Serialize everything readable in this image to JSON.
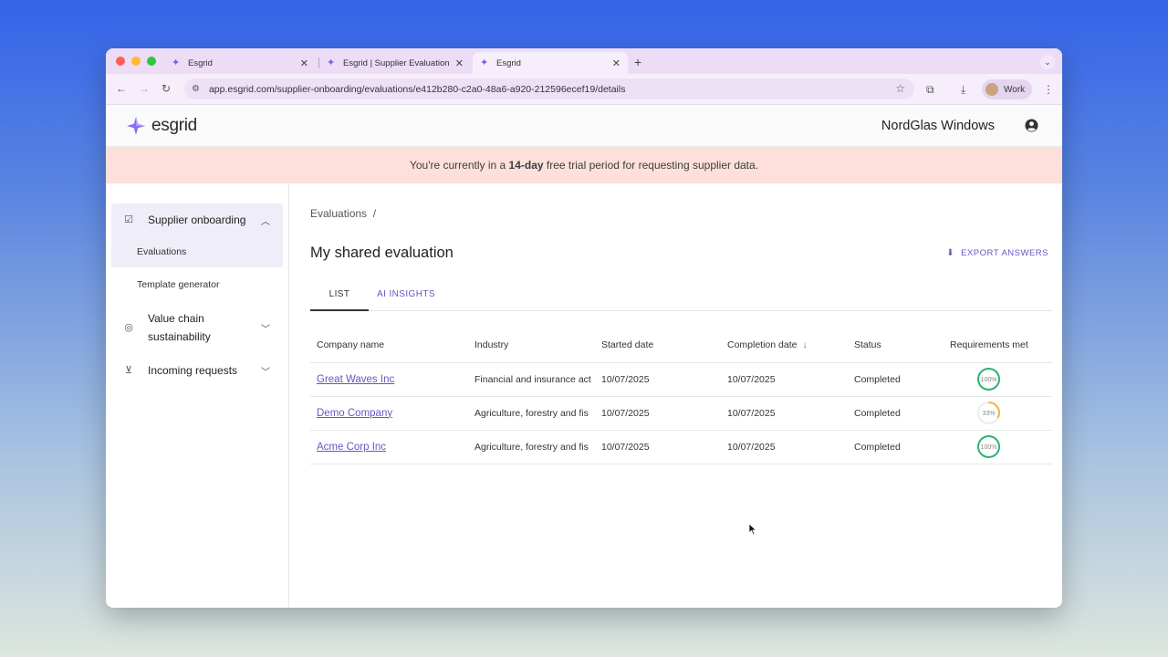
{
  "browser": {
    "tabs": [
      {
        "title": "Esgrid"
      },
      {
        "title": "Esgrid | Supplier Evaluation To"
      },
      {
        "title": "Esgrid"
      }
    ],
    "url": "app.esgrid.com/supplier-onboarding/evaluations/e412b280-c2a0-48a6-a920-212596ecef19/details",
    "profile_label": "Work"
  },
  "app": {
    "logo_text": "esgrid",
    "org_name": "NordGlas Windows",
    "brand_color": "#7b5ce6"
  },
  "banner": {
    "prefix": "You're currently in a ",
    "highlight": "14-day",
    "suffix": " free trial period for requesting supplier data."
  },
  "sidebar": {
    "items": [
      {
        "label": "Supplier onboarding",
        "icon": "checklist-icon",
        "expanded": true
      },
      {
        "label": "Value chain sustainability",
        "icon": "globe-icon",
        "expanded": false
      },
      {
        "label": "Incoming requests",
        "icon": "inbox-download-icon",
        "expanded": false
      }
    ],
    "subitems": [
      {
        "label": "Evaluations",
        "active": true
      },
      {
        "label": "Template generator",
        "active": false
      }
    ]
  },
  "main": {
    "breadcrumb": "Evaluations  /",
    "title": "My shared evaluation",
    "export_label": "EXPORT ANSWERS",
    "tabs": [
      {
        "label": "LIST",
        "selected": true
      },
      {
        "label": "AI INSIGHTS",
        "selected": false
      }
    ],
    "table": {
      "columns": [
        "Company name",
        "Industry",
        "Started date",
        "Completion date",
        "Status",
        "Requirements met"
      ],
      "rows": [
        {
          "company": "Great Waves Inc",
          "industry": "Financial and insurance act",
          "started": "10/07/2025",
          "completed": "10/07/2025",
          "status": "Completed",
          "requirements": 100,
          "requirements_label": "100%",
          "color": "#2bb673"
        },
        {
          "company": "Demo Company",
          "industry": "Agriculture, forestry and fis",
          "started": "10/07/2025",
          "completed": "10/07/2025",
          "status": "Completed",
          "requirements": 33,
          "requirements_label": "33%",
          "color": "#f2b63a"
        },
        {
          "company": "Acme Corp Inc",
          "industry": "Agriculture, forestry and fis",
          "started": "10/07/2025",
          "completed": "10/07/2025",
          "status": "Completed",
          "requirements": 100,
          "requirements_label": "100%",
          "color": "#2bb673"
        }
      ]
    }
  }
}
